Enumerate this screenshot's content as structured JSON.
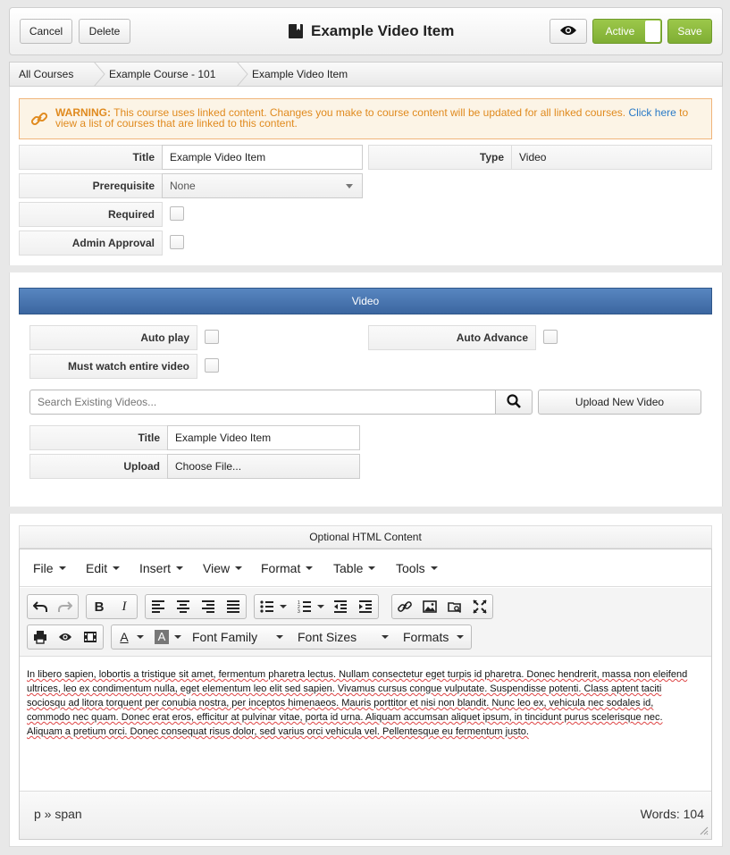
{
  "header": {
    "cancel_label": "Cancel",
    "delete_label": "Delete",
    "title": "Example Video Item",
    "active_label": "Active",
    "save_label": "Save"
  },
  "breadcrumb": [
    "All Courses",
    "Example Course - 101",
    "Example Video Item"
  ],
  "warning": {
    "prefix": "WARNING:",
    "text": " This course uses linked content. Changes you make to course content will be updated for all linked courses. ",
    "link": "Click here",
    "suffix": " to view a list of courses that are linked to this content."
  },
  "form": {
    "title_label": "Title",
    "title_value": "Example Video Item",
    "type_label": "Type",
    "type_value": "Video",
    "prereq_label": "Prerequisite",
    "prereq_value": "None",
    "required_label": "Required",
    "approval_label": "Admin Approval"
  },
  "video": {
    "section_title": "Video",
    "autoplay_label": "Auto play",
    "autoadvance_label": "Auto Advance",
    "mustwatch_label": "Must watch entire video",
    "search_placeholder": "Search Existing Videos...",
    "upload_new_label": "Upload New Video",
    "title_label": "Title",
    "title_value": "Example Video Item",
    "upload_label": "Upload",
    "choose_file_label": "Choose File..."
  },
  "editor": {
    "heading": "Optional HTML Content",
    "menus": [
      "File",
      "Edit",
      "Insert",
      "View",
      "Format",
      "Table",
      "Tools"
    ],
    "font_family": "Font Family",
    "font_sizes": "Font Sizes",
    "formats": "Formats",
    "content": "In libero sapien, lobortis a tristique sit amet, fermentum pharetra lectus. Nullam consectetur eget turpis id pharetra. Donec hendrerit, massa non eleifend ultrices, leo ex condimentum nulla, eget elementum leo elit sed sapien. Vivamus cursus congue vulputate. Suspendisse potenti. Class aptent taciti sociosqu ad litora torquent per conubia nostra, per inceptos himenaeos. Mauris porttitor et nisi non blandit. Nunc leo ex, vehicula nec sodales id, commodo nec quam. Donec erat eros, efficitur at pulvinar vitae, porta id urna. Aliquam accumsan aliquet ipsum, in tincidunt purus scelerisque nec. Aliquam a pretium orci. Donec consequat risus dolor, sed varius orci vehicula vel. Pellentesque eu fermentum justo.",
    "path": "p » span",
    "word_count": "Words: 104"
  },
  "colors": {
    "accent_green": "#8ab83c",
    "section_blue": "#3f6eaa",
    "warning_orange": "#e08a1e",
    "link_blue": "#2a7ac7"
  }
}
